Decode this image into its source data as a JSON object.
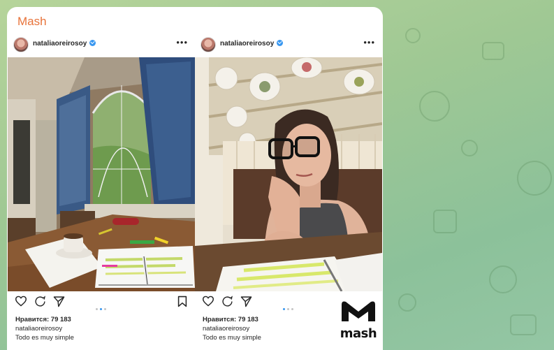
{
  "channel": {
    "title": "Mash"
  },
  "posts": [
    {
      "username": "nataliaoreirosoy",
      "more": "•••",
      "likes": "Нравится: 79 183",
      "caption_user": "nataliaoreirosoy",
      "caption_text": "Todo es muy simple",
      "photo_icon": "room-window-desk-photo"
    },
    {
      "username": "nataliaoreirosoy",
      "more": "•••",
      "likes": "Нравится: 79 183",
      "caption_user": "nataliaoreirosoy",
      "caption_text": "Todo es muy simple",
      "photo_icon": "woman-glasses-selfie-photo"
    }
  ],
  "carousel": {
    "total": 3,
    "active": 2
  },
  "logo": {
    "text": "mash"
  },
  "colors": {
    "brand": "#e8733a",
    "verified": "#3897f0",
    "background": "#9fc894",
    "logo": "#111111"
  }
}
